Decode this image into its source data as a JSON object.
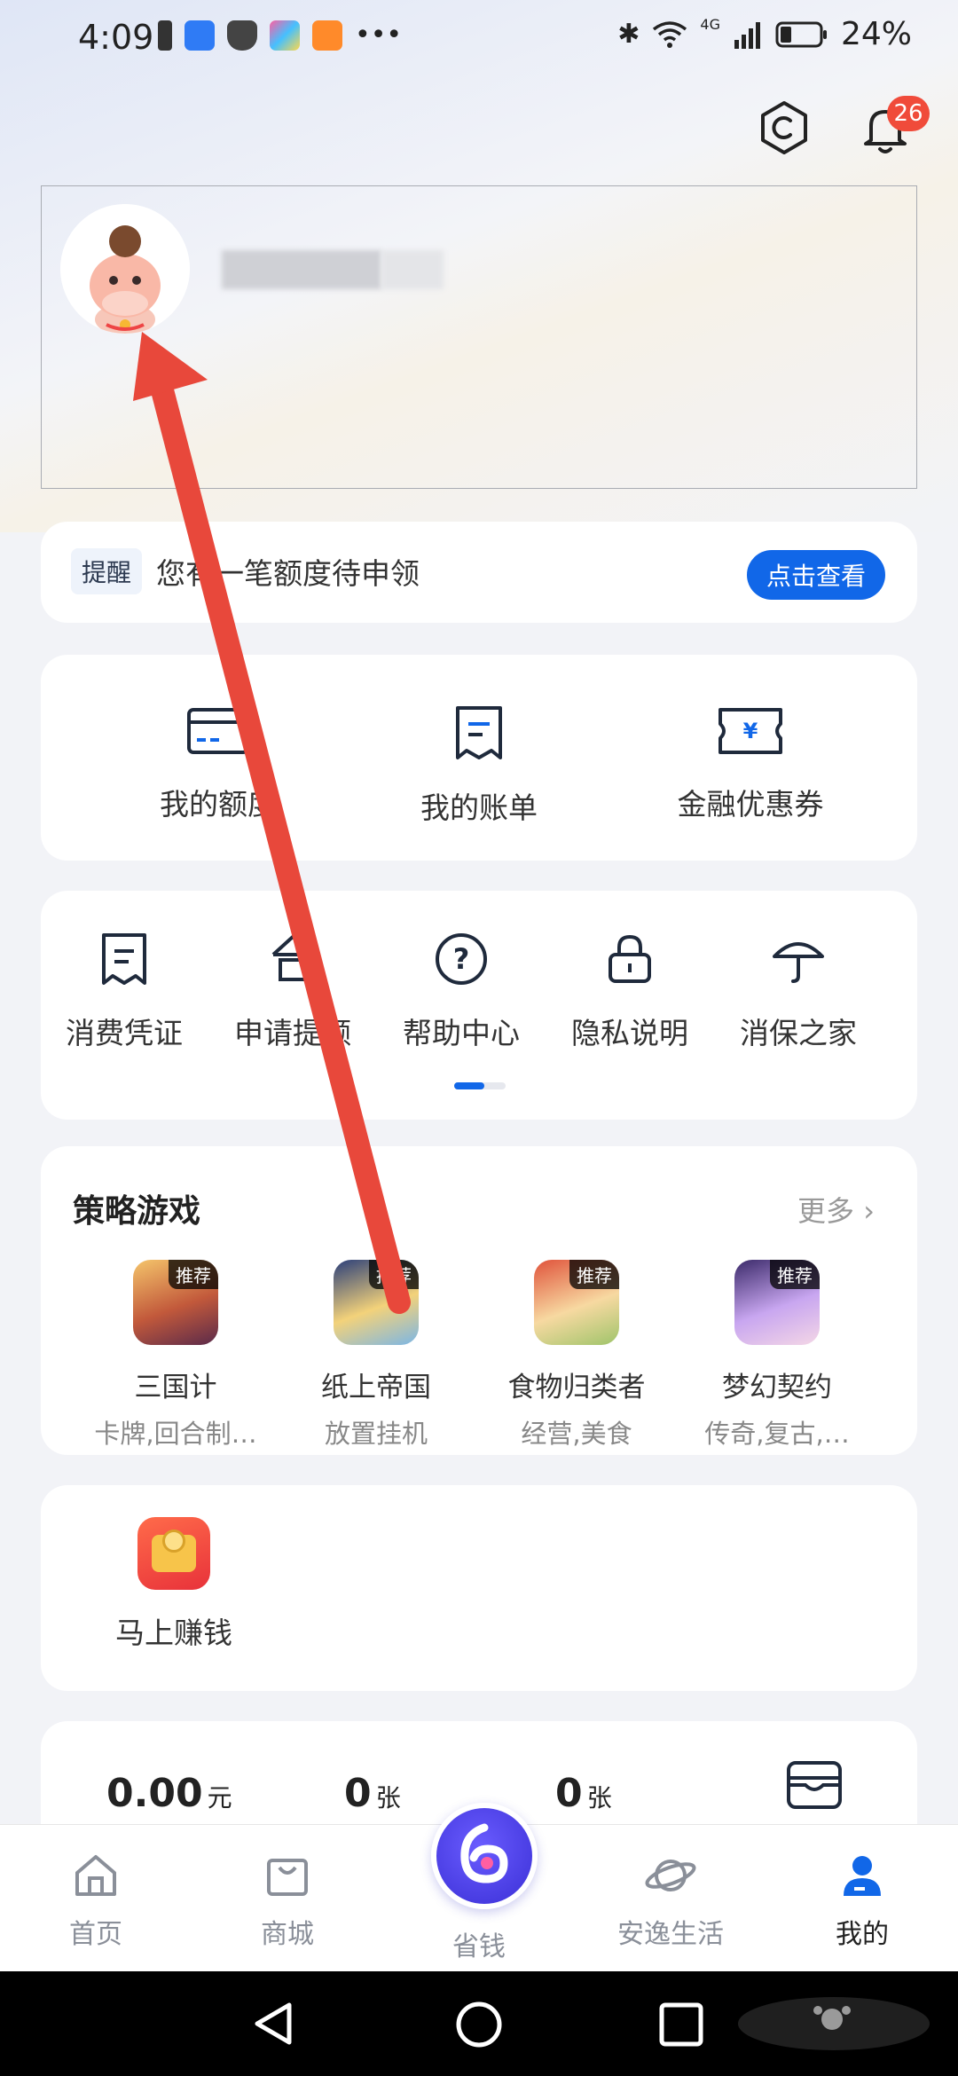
{
  "status_bar": {
    "time": "4:09",
    "battery": "24%",
    "network": "4G"
  },
  "header": {
    "notification_count": "26"
  },
  "remind": {
    "tag": "提醒",
    "text": "您有一笔额度待申领",
    "button": "点击查看"
  },
  "quick_menu": {
    "items": [
      {
        "label": "我的额度",
        "icon": "card-icon"
      },
      {
        "label": "我的账单",
        "icon": "bill-icon"
      },
      {
        "label": "金融优惠券",
        "icon": "coupon-icon"
      }
    ]
  },
  "services": {
    "items": [
      {
        "label": "消费凭证",
        "icon": "receipt-icon"
      },
      {
        "label": "申请提额",
        "icon": "upgrade-icon"
      },
      {
        "label": "帮助中心",
        "icon": "question-icon"
      },
      {
        "label": "隐私说明",
        "icon": "lock-icon"
      },
      {
        "label": "消保之家",
        "icon": "umbrella-icon"
      }
    ]
  },
  "games": {
    "title": "策略游戏",
    "more": "更多",
    "tag": "推荐",
    "items": [
      {
        "name": "三国计",
        "desc": "卡牌,回合制…"
      },
      {
        "name": "纸上帝国",
        "desc": "放置挂机"
      },
      {
        "name": "食物归类者",
        "desc": "经营,美食"
      },
      {
        "name": "梦幻契约",
        "desc": "传奇,复古,…"
      }
    ]
  },
  "earn": {
    "label": "马上赚钱"
  },
  "assets": {
    "amount": "0.00",
    "amount_unit": "元",
    "count1": "0",
    "count1_unit": "张",
    "count2": "0",
    "count2_unit": "张"
  },
  "tabbar": {
    "items": [
      {
        "label": "首页",
        "icon": "home-icon"
      },
      {
        "label": "商城",
        "icon": "bag-icon"
      },
      {
        "label": "省钱",
        "icon": "save-money-icon"
      },
      {
        "label": "安逸生活",
        "icon": "planet-icon"
      },
      {
        "label": "我的",
        "icon": "user-icon"
      }
    ]
  },
  "colors": {
    "accent": "#1167e8",
    "badge": "#f04b3a",
    "arrow": "#e8483b"
  }
}
